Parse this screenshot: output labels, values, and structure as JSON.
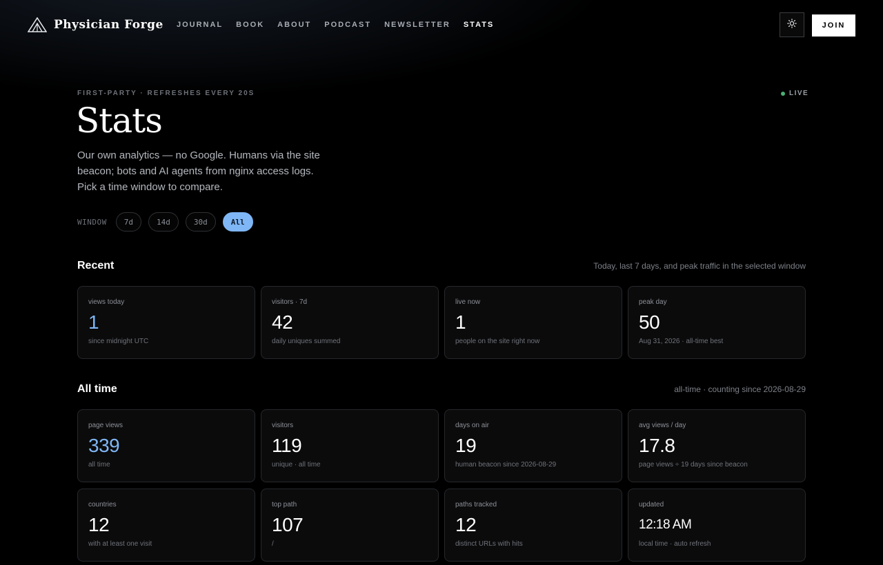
{
  "header": {
    "brand": "Physician Forge",
    "nav": [
      "JOURNAL",
      "BOOK",
      "ABOUT",
      "PODCAST",
      "NEWSLETTER",
      "STATS"
    ],
    "active_nav": "STATS",
    "join_label": "JOIN",
    "theme_icon": "sun-icon",
    "logo_icon": "triangle-mountain-icon"
  },
  "hero": {
    "eyebrow": "FIRST-PARTY · REFRESHES EVERY 20S",
    "live_label": "LIVE",
    "live_color": "#4caf73",
    "title": "Stats",
    "description": "Our own analytics — no Google. Humans via the site beacon; bots and AI agents from nginx access logs. Pick a time window to compare."
  },
  "window": {
    "label": "WINDOW",
    "options": [
      "7d",
      "14d",
      "30d",
      "All"
    ],
    "selected": "All"
  },
  "recent": {
    "title": "Recent",
    "note": "Today, last 7 days, and peak traffic in the selected window",
    "cards": [
      {
        "label": "views today",
        "value": "1",
        "sub": "since midnight UTC"
      },
      {
        "label": "visitors · 7d",
        "value": "42",
        "sub": "daily uniques summed"
      },
      {
        "label": "live now",
        "value": "1",
        "sub": "people on the site right now"
      },
      {
        "label": "peak day",
        "value": "50",
        "sub": "Aug 31, 2026 · all-time best"
      }
    ]
  },
  "alltime": {
    "title": "All time",
    "note": "all-time · counting since 2026-08-29",
    "cards": [
      {
        "label": "page views",
        "value": "339",
        "sub": "all time"
      },
      {
        "label": "visitors",
        "value": "119",
        "sub": "unique · all time"
      },
      {
        "label": "days on air",
        "value": "19",
        "sub": "human beacon since 2026-08-29"
      },
      {
        "label": "avg views / day",
        "value": "17.8",
        "sub": "page views ÷ 19 days since beacon"
      },
      {
        "label": "countries",
        "value": "12",
        "sub": "with at least one visit"
      },
      {
        "label": "top path",
        "value": "107",
        "sub": "/"
      },
      {
        "label": "paths tracked",
        "value": "12",
        "sub": "distinct URLs with hits"
      },
      {
        "label": "updated",
        "value": "12:18 AM",
        "sub": "local time · auto refresh"
      }
    ]
  },
  "colors": {
    "accent": "#7fb6f5",
    "background": "#000000"
  }
}
